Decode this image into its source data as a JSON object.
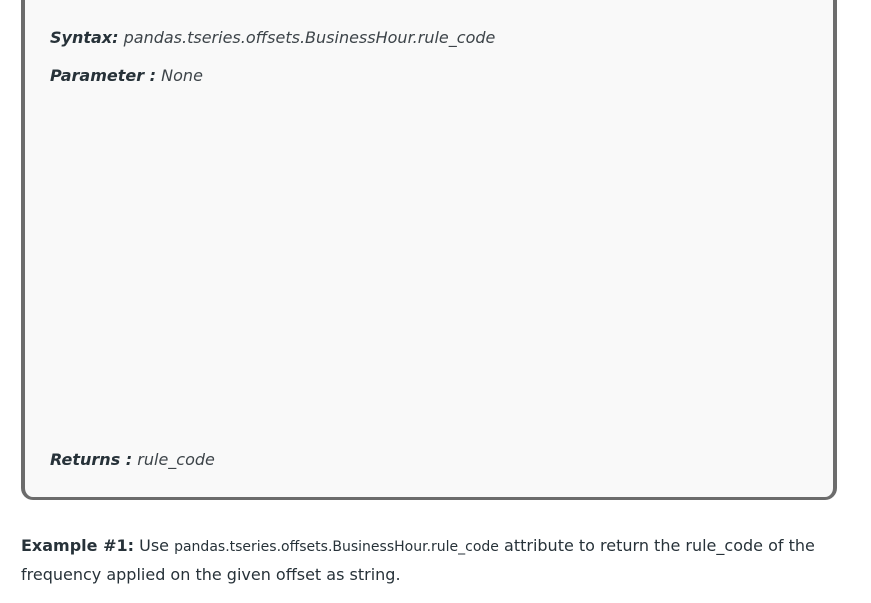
{
  "syntax_box": {
    "syntax_label": "Syntax:",
    "syntax_value": "pandas.tseries.offsets.BusinessHour.rule_code",
    "parameter_label": "Parameter :",
    "parameter_value": "None",
    "returns_label": "Returns :",
    "returns_value": "rule_code"
  },
  "example": {
    "label": "Example #1:",
    "text_before": "Use",
    "code": "pandas.tseries.offsets.BusinessHour.rule_code",
    "text_after": "attribute to return the rule_code of the frequency applied on the given offset as string."
  }
}
